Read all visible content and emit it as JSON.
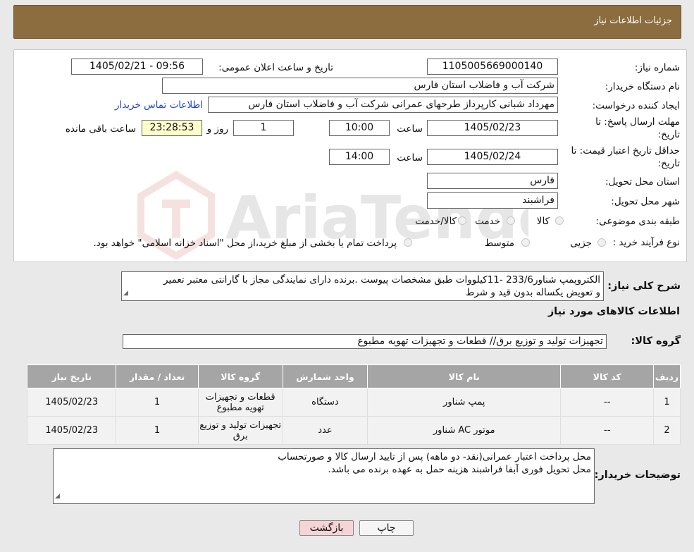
{
  "header": {
    "title": "جزئیات اطلاعات نیاز"
  },
  "fields": {
    "need_number_label": "شماره نیاز:",
    "need_number": "1105005669000140",
    "announce_label": "تاریخ و ساعت اعلان عمومی:",
    "announce_value": "1405/02/21 - 09:56",
    "buyer_org_label": "نام دستگاه خریدار:",
    "buyer_org": "شرکت آب و فاضلاب استان فارس",
    "creator_label": "ایجاد کننده درخواست:",
    "creator": "مهرداد شبانی کارپرداز طرحهای عمرانی  شرکت آب و فاضلاب استان فارس",
    "contact_link": "اطلاعات تماس خریدار",
    "deadline_label_1": "مهلت ارسال پاسخ: تا",
    "deadline_label_2": "تاریخ:",
    "deadline_date": "1405/02/23",
    "time_label": "ساعت",
    "deadline_time": "10:00",
    "days_value": "1",
    "days_label": "روز و",
    "remaining_time": "23:28:53",
    "remaining_label": "ساعت باقی مانده",
    "validity_label_1": "حداقل تاریخ اعتبار قیمت: تا",
    "validity_label_2": "تاریخ:",
    "validity_date": "1405/02/24",
    "validity_time": "14:00",
    "province_label": "استان محل تحویل:",
    "province": "فارس",
    "city_label": "شهر محل تحویل:",
    "city": "فراشبند",
    "category_label": "طبقه بندی موضوعی:",
    "category_options": [
      "کالا",
      "خدمت",
      "کالا/خدمت"
    ],
    "purchase_label": "نوع فرآیند خرید :",
    "purchase_options": [
      "جزیی",
      "متوسط"
    ],
    "purchase_note": "پرداخت تمام یا بخشی از مبلغ خرید،از محل \"اسناد خزانه اسلامی\" خواهد بود."
  },
  "description": {
    "label": "شرح کلی نیاز:",
    "text_line1": "الکتروپمپ  شناور233/6 -11کیلووات طبق مشخصات پیوست  .برنده دارای نمایندگی مجاز با گارانتی معتبر تعمیر",
    "text_line2": "و تعویض یکساله بدون قید و شرط"
  },
  "goods_section": {
    "title": "اطلاعات کالاهای مورد نیاز",
    "group_label": "گروه کالا:",
    "group_value": "تجهیزات تولید و توزیع برق//  قطعات و تجهیزات تهویه مطبوع"
  },
  "table": {
    "headers": [
      "ردیف",
      "کد کالا",
      "نام کالا",
      "واحد شمارش",
      "گروه کالا",
      "تعداد / مقدار",
      "تاریخ نیاز"
    ],
    "rows": [
      [
        "1",
        "--",
        "پمپ شناور",
        "دستگاه",
        "قطعات و تجهیزات تهویه مطبوع",
        "1",
        "1405/02/23"
      ],
      [
        "2",
        "--",
        "موتور AC شناور",
        "عدد",
        "تجهیزات تولید و توزیع برق",
        "1",
        "1405/02/23"
      ]
    ]
  },
  "buyer_notes": {
    "label": "توضیحات خریدار:",
    "line1": "محل پرداخت اعتبار عمرانی(نقد- دو ماهه) پس از تایید ارسال کالا و صورتحساب",
    "line2": "محل تحویل فوری آبفا فراشبند هزینه حمل به عهده برنده می باشد."
  },
  "buttons": {
    "print": "چاپ",
    "back": "بازگشت"
  },
  "watermark_text": "AriaTender.neT",
  "colors": {
    "header": "#8c6d3f",
    "table_header": "#a5a5a5",
    "link": "#2244cc",
    "back_button": "#f4d4d4"
  }
}
